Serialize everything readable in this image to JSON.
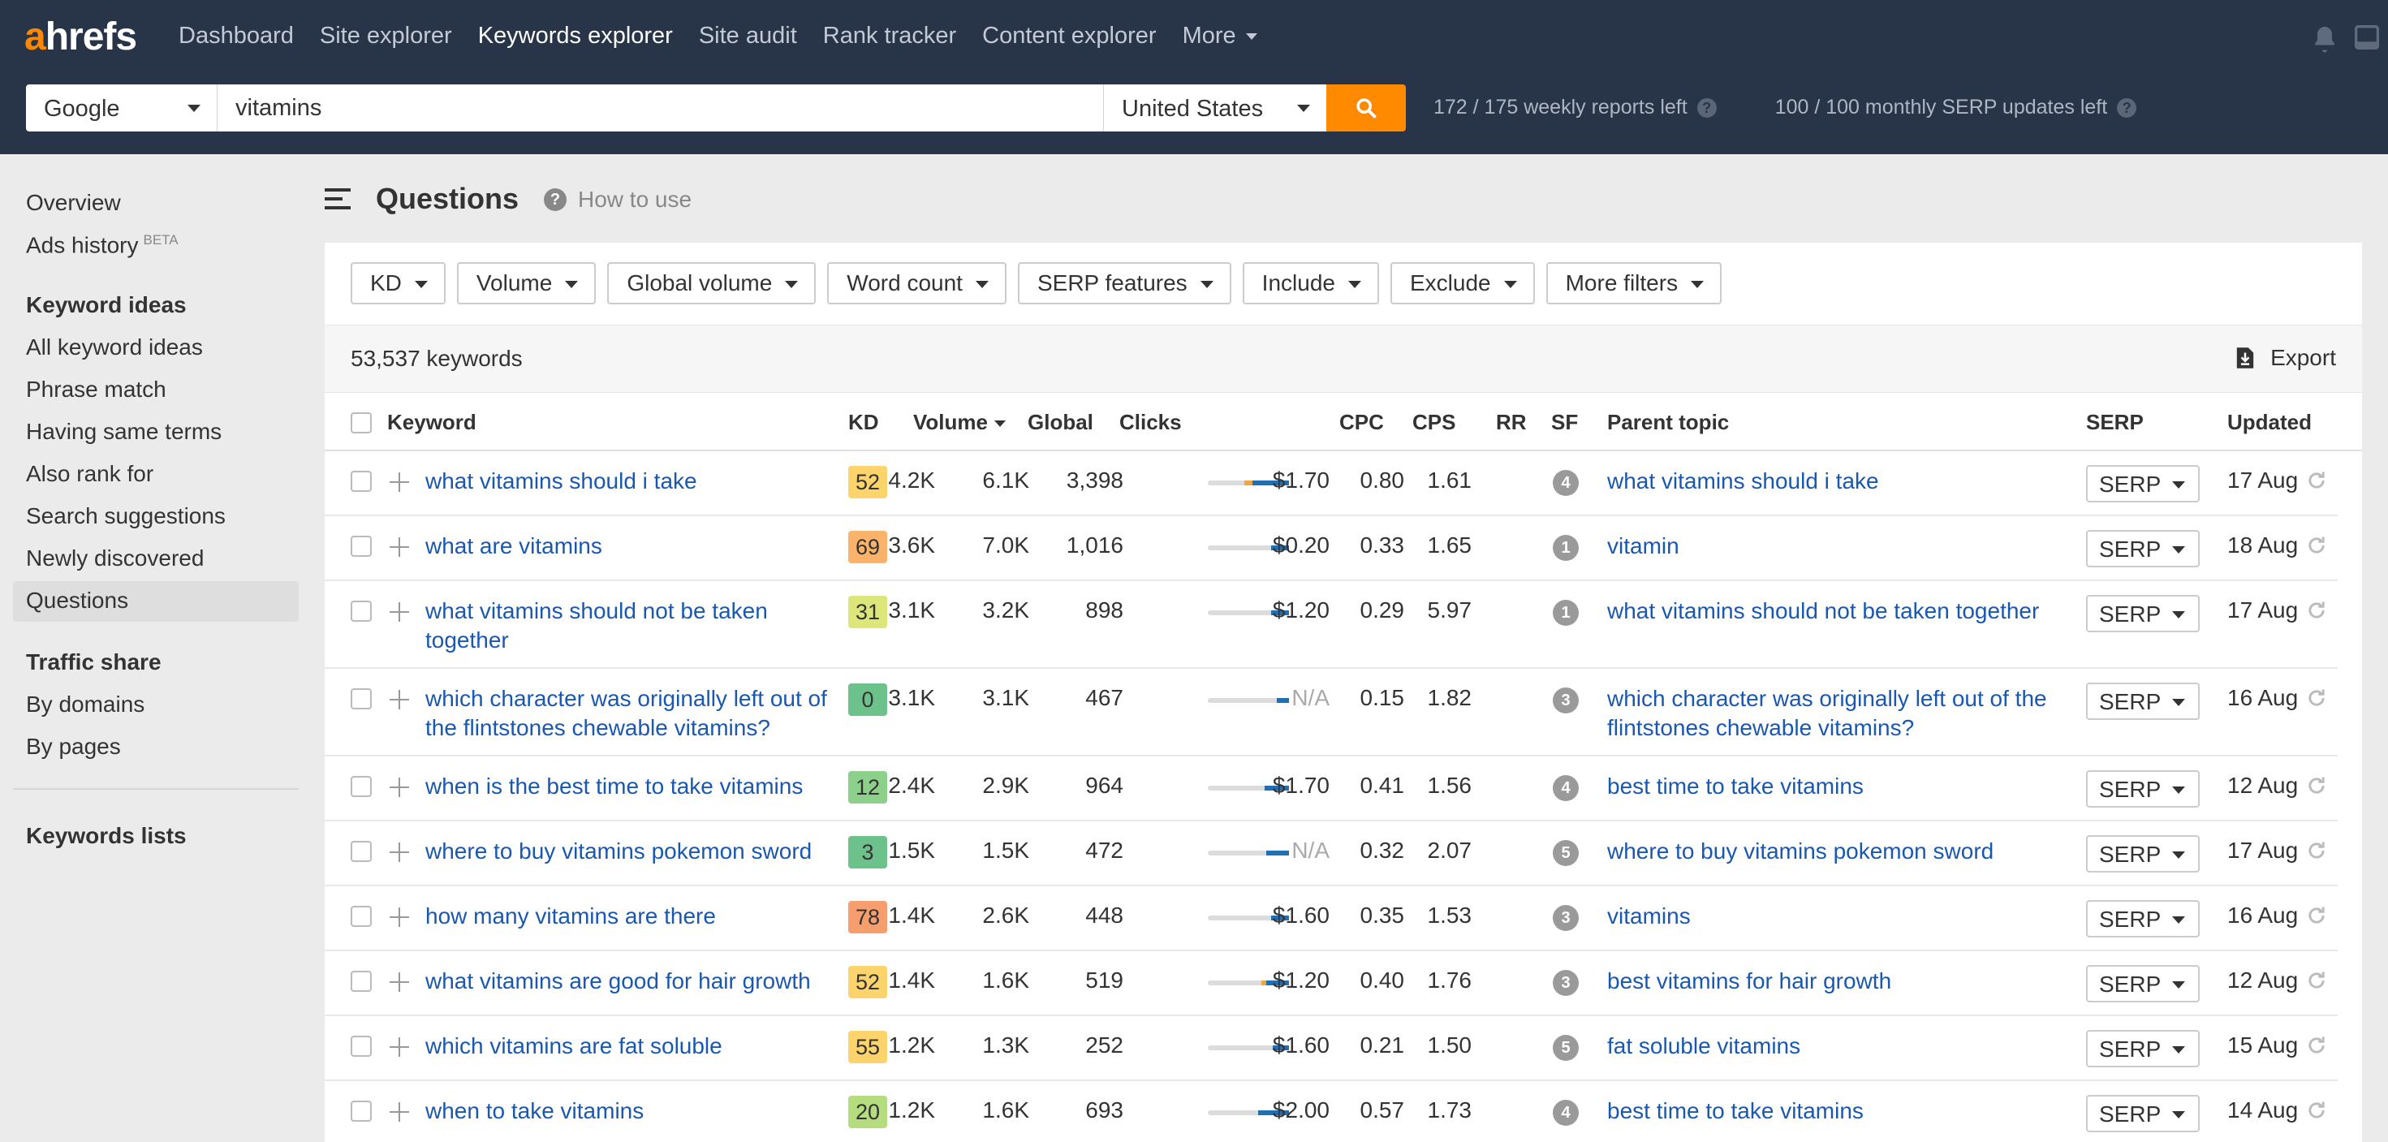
{
  "nav": {
    "logo_a": "a",
    "logo_rest": "hrefs",
    "links": [
      "Dashboard",
      "Site explorer",
      "Keywords explorer",
      "Site audit",
      "Rank tracker",
      "Content explorer",
      "More"
    ],
    "active_link": "Keywords explorer"
  },
  "search": {
    "engine": "Google",
    "query": "vitamins",
    "country": "United States",
    "weekly_reports": "172 / 175 weekly reports left",
    "serp_updates": "100 / 100 monthly SERP updates left"
  },
  "sidebar": {
    "overview": "Overview",
    "ads_history": "Ads history",
    "beta": "BETA",
    "keyword_ideas_header": "Keyword ideas",
    "keyword_ideas": [
      "All keyword ideas",
      "Phrase match",
      "Having same terms",
      "Also rank for",
      "Search suggestions",
      "Newly discovered",
      "Questions"
    ],
    "active_item": "Questions",
    "traffic_share_header": "Traffic share",
    "traffic_share": [
      "By domains",
      "By pages"
    ],
    "keywords_lists": "Keywords lists"
  },
  "page": {
    "title": "Questions",
    "how_to_use": "How to use"
  },
  "filters": [
    "KD",
    "Volume",
    "Global volume",
    "Word count",
    "SERP features",
    "Include",
    "Exclude",
    "More filters"
  ],
  "results": {
    "count_label": "53,537 keywords",
    "export_label": "Export"
  },
  "table": {
    "columns": {
      "keyword": "Keyword",
      "kd": "KD",
      "volume": "Volume",
      "global": "Global",
      "clicks": "Clicks",
      "cpc": "CPC",
      "cps": "CPS",
      "rr": "RR",
      "sf": "SF",
      "parent_topic": "Parent topic",
      "serp": "SERP",
      "updated": "Updated"
    },
    "serp_button_label": "SERP",
    "rows": [
      {
        "keyword": "what vitamins should i take",
        "kd": "52",
        "kd_color": "#fdd36b",
        "volume": "4.2K",
        "global": "6.1K",
        "clicks": "3,398",
        "click_split": [
          0.55,
          0.1
        ],
        "cpc": "$1.70",
        "cps": "0.80",
        "rr": "1.61",
        "sf": "4",
        "parent": "what vitamins should i take",
        "updated": "17 Aug"
      },
      {
        "keyword": "what are vitamins",
        "kd": "69",
        "kd_color": "#fbb26a",
        "volume": "3.6K",
        "global": "7.0K",
        "clicks": "1,016",
        "click_split": [
          0.78,
          0.0
        ],
        "cpc": "$0.20",
        "cps": "0.33",
        "rr": "1.65",
        "sf": "1",
        "parent": "vitamin",
        "updated": "18 Aug"
      },
      {
        "keyword": "what vitamins should not be taken together",
        "kd": "31",
        "kd_color": "#dce67a",
        "volume": "3.1K",
        "global": "3.2K",
        "clicks": "898",
        "click_split": [
          0.78,
          0.0
        ],
        "cpc": "$1.20",
        "cps": "0.29",
        "rr": "5.97",
        "sf": "1",
        "parent": "what vitamins should not be taken together",
        "updated": "17 Aug"
      },
      {
        "keyword": "which character was originally left out of the flintstones chewable vitamins?",
        "kd": "0",
        "kd_color": "#6cc28a",
        "volume": "3.1K",
        "global": "3.1K",
        "clicks": "467",
        "click_split": [
          0.85,
          0.0
        ],
        "cpc": "N/A",
        "cps": "0.15",
        "rr": "1.82",
        "sf": "3",
        "parent": "which character was originally left out of the flintstones chewable vitamins?",
        "updated": "16 Aug"
      },
      {
        "keyword": "when is the best time to take vitamins",
        "kd": "12",
        "kd_color": "#8cd08c",
        "volume": "2.4K",
        "global": "2.9K",
        "clicks": "964",
        "click_split": [
          0.7,
          0.0
        ],
        "cpc": "$1.70",
        "cps": "0.41",
        "rr": "1.56",
        "sf": "4",
        "parent": "best time to take vitamins",
        "updated": "12 Aug"
      },
      {
        "keyword": "where to buy vitamins pokemon sword",
        "kd": "3",
        "kd_color": "#6cc28a",
        "volume": "1.5K",
        "global": "1.5K",
        "clicks": "472",
        "click_split": [
          0.72,
          0.0
        ],
        "cpc": "N/A",
        "cps": "0.32",
        "rr": "2.07",
        "sf": "5",
        "parent": "where to buy vitamins pokemon sword",
        "updated": "17 Aug"
      },
      {
        "keyword": "how many vitamins are there",
        "kd": "78",
        "kd_color": "#f79e6f",
        "volume": "1.4K",
        "global": "2.6K",
        "clicks": "448",
        "click_split": [
          0.78,
          0.0
        ],
        "cpc": "$1.60",
        "cps": "0.35",
        "rr": "1.53",
        "sf": "3",
        "parent": "vitamins",
        "updated": "16 Aug"
      },
      {
        "keyword": "what vitamins are good for hair growth",
        "kd": "52",
        "kd_color": "#fdd36b",
        "volume": "1.4K",
        "global": "1.6K",
        "clicks": "519",
        "click_split": [
          0.72,
          0.06
        ],
        "cpc": "$1.20",
        "cps": "0.40",
        "rr": "1.76",
        "sf": "3",
        "parent": "best vitamins for hair growth",
        "updated": "12 Aug"
      },
      {
        "keyword": "which vitamins are fat soluble",
        "kd": "55",
        "kd_color": "#fdd36b",
        "volume": "1.2K",
        "global": "1.3K",
        "clicks": "252",
        "click_split": [
          0.8,
          0.0
        ],
        "cpc": "$1.60",
        "cps": "0.21",
        "rr": "1.50",
        "sf": "5",
        "parent": "fat soluble vitamins",
        "updated": "15 Aug"
      },
      {
        "keyword": "when to take vitamins",
        "kd": "20",
        "kd_color": "#b6dc80",
        "volume": "1.2K",
        "global": "1.6K",
        "clicks": "693",
        "click_split": [
          0.62,
          0.0
        ],
        "cpc": "$2.00",
        "cps": "0.57",
        "rr": "1.73",
        "sf": "4",
        "parent": "best time to take vitamins",
        "updated": "14 Aug"
      }
    ]
  },
  "colors": {
    "topbar": "#283447",
    "accent": "#ff8a00",
    "link": "#1a58b0",
    "clicks_organic": "#1f6fb5",
    "clicks_paid": "#f0a640"
  }
}
